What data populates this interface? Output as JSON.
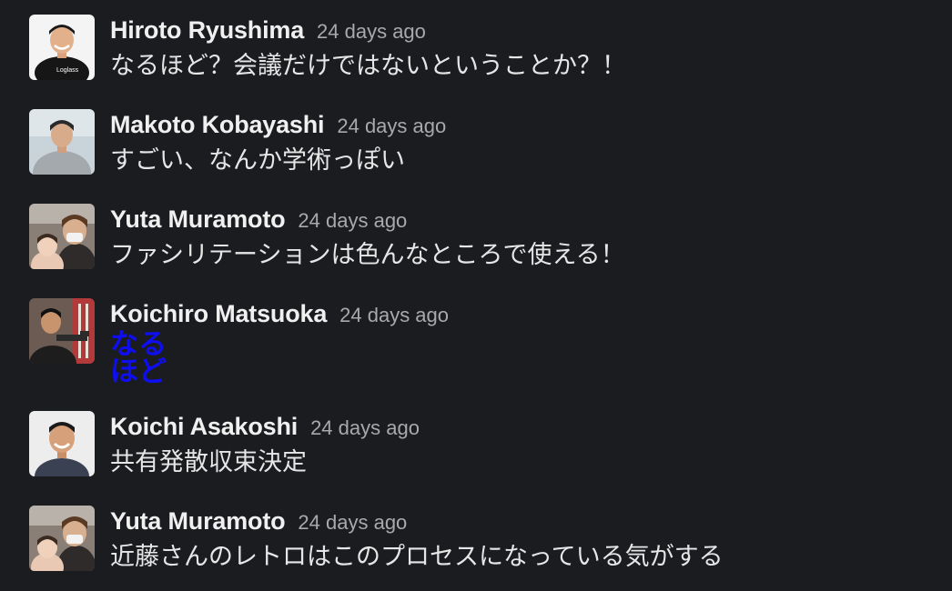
{
  "messages": [
    {
      "author": "Hiroto Ryushima",
      "time": "24 days ago",
      "text": "なるほど？会議だけではないということか？！"
    },
    {
      "author": "Makoto Kobayashi",
      "time": "24 days ago",
      "text": "すごい、なんか学術っぽい"
    },
    {
      "author": "Yuta Muramoto",
      "time": "24 days ago",
      "text": "ファシリテーションは色んなところで使える！"
    },
    {
      "author": "Koichiro Matsuoka",
      "time": "24 days ago",
      "text_line1": "なる",
      "text_line2": "ほど"
    },
    {
      "author": "Koichi Asakoshi",
      "time": "24 days ago",
      "text": "共有発散収束決定"
    },
    {
      "author": "Yuta Muramoto",
      "time": "24 days ago",
      "text": "近藤さんのレトロはこのプロセスになっている気がする"
    }
  ],
  "colors": {
    "background": "#1b1c20",
    "author": "#f0f0f0",
    "timestamp": "#a9a9ad",
    "message": "#e6e6e6",
    "emoji_text": "#0e0ef0"
  }
}
